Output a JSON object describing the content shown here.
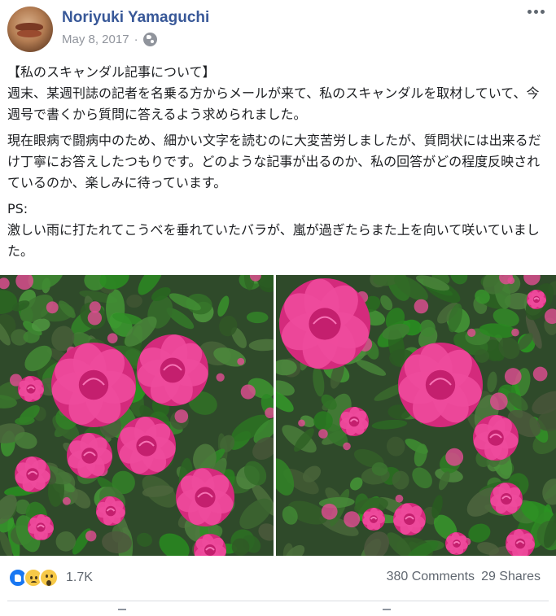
{
  "header": {
    "author": "Noriyuki Yamaguchi",
    "date": "May 8, 2017",
    "date_separator": "·",
    "privacy_icon": "globe-icon",
    "more_icon": "more-options-icon"
  },
  "post": {
    "paragraphs": [
      "【私のスキャンダル記事について】\n週末、某週刊誌の記者を名乗る方からメールが来て、私のスキャンダルを取材していて、今週号で書くから質問に答えるよう求められました。",
      "現在眼病で闘病中のため、細かい文字を読むのに大変苦労しましたが、質問状には出来るだけ丁寧にお答えしたつもりです。どのような記事が出るのか、私の回答がどの程度反映されているのか、楽しみに待っています。",
      "PS:\n激しい雨に打たれてこうべを垂れていたバラが、嵐が過ぎたらまた上を向いて咲いていました。"
    ]
  },
  "photos": [
    {
      "subject": "pink roses with green leaves"
    },
    {
      "subject": "pink roses with green leaves"
    }
  ],
  "footer": {
    "reaction_icons": [
      "like-icon",
      "sad-icon",
      "wow-icon"
    ],
    "reaction_count": "1.7K",
    "comments": "380 Comments",
    "shares": "29 Shares"
  },
  "colors": {
    "author": "#385898",
    "meta": "#90949c",
    "rose": "#e8358a",
    "leaf": "#3f6b3a"
  }
}
